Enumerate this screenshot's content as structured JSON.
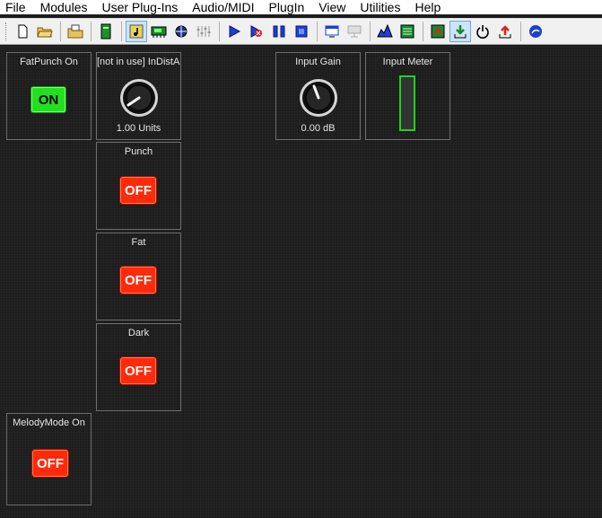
{
  "menu": [
    "File",
    "Modules",
    "User Plug-Ins",
    "Audio/MIDI",
    "PlugIn",
    "View",
    "Utilities",
    "Help"
  ],
  "toolbar": {
    "icons": [
      "new-file-icon",
      "open-file-icon",
      "open-folder-icon",
      "green-module-icon",
      "note-icon",
      "circuit-icon",
      "clock-icon",
      "mixer-icon",
      "play-icon",
      "record-icon",
      "pause-icon",
      "stop-icon",
      "window-icon",
      "export-icon",
      "graph-icon",
      "grid-icon",
      "piano-roll-icon",
      "download-icon",
      "power-icon",
      "upload-icon",
      "help-icon"
    ]
  },
  "modules": {
    "fatpunch": {
      "title": "FatPunch On",
      "state": "ON"
    },
    "indist": {
      "title": "[not in use] InDistAmt",
      "value": "1.00 Units",
      "knob_level": 0.05
    },
    "punch": {
      "title": "Punch",
      "state": "OFF"
    },
    "fat": {
      "title": "Fat",
      "state": "OFF"
    },
    "dark": {
      "title": "Dark",
      "state": "OFF"
    },
    "melody": {
      "title": "MelodyMode On",
      "state": "OFF"
    },
    "input_gain": {
      "title": "Input Gain",
      "value": "0.00 dB",
      "knob_level": 0.5
    },
    "input_meter": {
      "title": "Input Meter",
      "level": 0
    }
  },
  "colors": {
    "on": "#22e01f",
    "off": "#ff2a0a",
    "meter": "#1fd41c",
    "background": "#1d1d1d"
  }
}
